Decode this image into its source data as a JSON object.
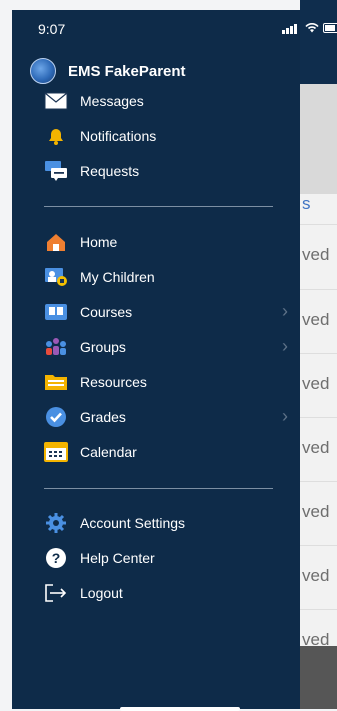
{
  "status": {
    "time": "9:07"
  },
  "profile": {
    "name": "EMS FakeParent"
  },
  "menu": {
    "messages": "Messages",
    "notifications": "Notifications",
    "requests": "Requests",
    "home": "Home",
    "my_children": "My Children",
    "courses": "Courses",
    "groups": "Groups",
    "resources": "Resources",
    "grades": "Grades",
    "calendar": "Calendar",
    "account_settings": "Account Settings",
    "help_center": "Help Center",
    "logout": "Logout"
  },
  "background": {
    "link_fragment": "s",
    "rows": [
      "ved",
      "ved",
      "ved",
      "ved",
      "ved",
      "ved",
      "ved"
    ]
  },
  "colors": {
    "drawer_bg": "#0e2b49",
    "text": "#ffffff",
    "divider": "#7c8fa3"
  },
  "icons": {
    "messages": "envelope-icon",
    "notifications": "bell-icon",
    "requests": "chat-icon",
    "home": "house-icon",
    "my_children": "children-icon",
    "courses": "book-icon",
    "groups": "group-icon",
    "resources": "folder-icon",
    "grades": "checkmark-badge-icon",
    "calendar": "calendar-icon",
    "account_settings": "gear-icon",
    "help_center": "question-icon",
    "logout": "logout-icon"
  }
}
